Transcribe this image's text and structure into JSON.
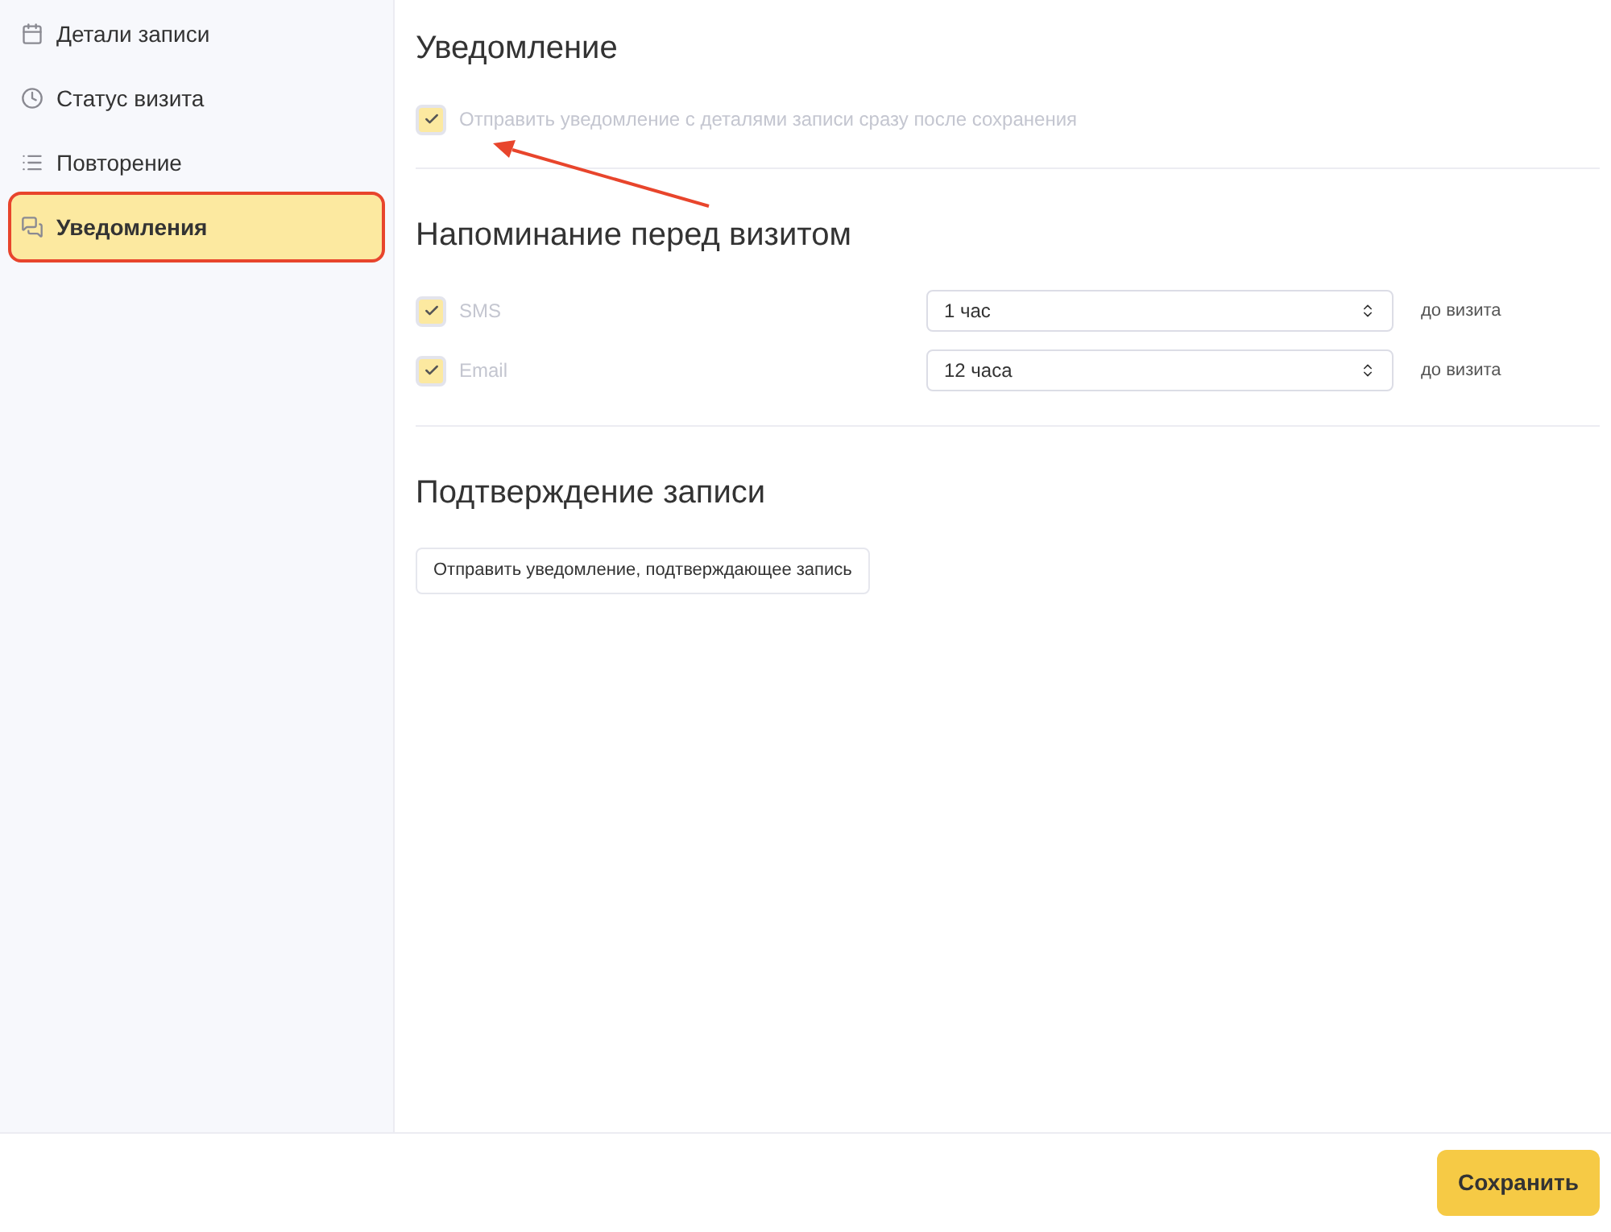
{
  "sidebar": {
    "items": [
      {
        "label": "Детали записи",
        "kind": "calendar",
        "selected": false,
        "annotated": false
      },
      {
        "label": "Статус визита",
        "kind": "clock",
        "selected": false,
        "annotated": false
      },
      {
        "label": "Повторение",
        "kind": "list",
        "selected": false,
        "annotated": false
      },
      {
        "label": "Уведомления",
        "kind": "chat",
        "selected": true,
        "annotated": true
      }
    ]
  },
  "notification": {
    "title": "Уведомление",
    "checkbox": {
      "label": "Отправить уведомление с деталями записи сразу после сохранения",
      "checked": true,
      "disabled": true,
      "annotated": true
    }
  },
  "reminder": {
    "title": "Напоминание перед визитом",
    "rows": [
      {
        "label": "SMS",
        "checked": true,
        "disabled": true,
        "value": "1 час",
        "suffix": "до визита"
      },
      {
        "label": "Email",
        "checked": true,
        "disabled": true,
        "value": "12 часа",
        "suffix": "до визита"
      }
    ]
  },
  "confirmation": {
    "title": "Подтверждение записи",
    "button": "Отправить уведомление, подтверждающее запись"
  },
  "footer": {
    "save_button": "Сохранить"
  }
}
